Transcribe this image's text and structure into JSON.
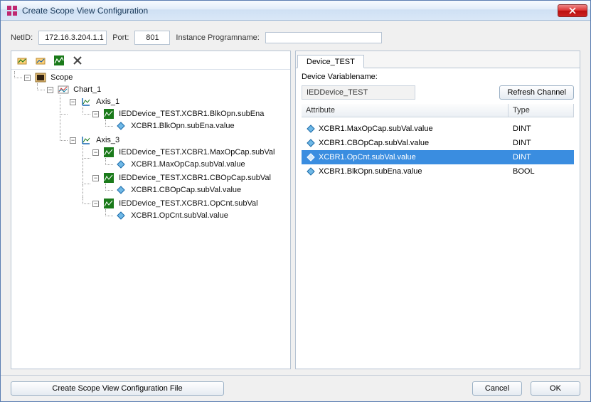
{
  "titlebar": {
    "title": "Create Scope View Configuration"
  },
  "form": {
    "netid_label": "NetID:",
    "netid_value": "172.16.3.204.1.1",
    "port_label": "Port:",
    "port_value": "801",
    "progname_label": "Instance Programname:",
    "progname_value": ""
  },
  "tree": {
    "root": {
      "label": "Scope",
      "chart": {
        "label": "Chart_1",
        "axis1": {
          "label": "Axis_1",
          "ch1": {
            "label": "IEDDevice_TEST.XCBR1.BlkOpn.subEna",
            "item": "XCBR1.BlkOpn.subEna.value"
          }
        },
        "axis3": {
          "label": "Axis_3",
          "ch1": {
            "label": "IEDDevice_TEST.XCBR1.MaxOpCap.subVal",
            "item": "XCBR1.MaxOpCap.subVal.value"
          },
          "ch2": {
            "label": "IEDDevice_TEST.XCBR1.CBOpCap.subVal",
            "item": "XCBR1.CBOpCap.subVal.value"
          },
          "ch3": {
            "label": "IEDDevice_TEST.XCBR1.OpCnt.subVal",
            "item": "XCBR1.OpCnt.subVal.value"
          }
        }
      }
    }
  },
  "right": {
    "tab": "Device_TEST",
    "varname_label": "Device Variablename:",
    "varname_value": "IEDDevice_TEST",
    "refresh_btn": "Refresh Channel",
    "col_attr": "Attribute",
    "col_type": "Type",
    "rows": [
      {
        "attr": "XCBR1.MaxOpCap.subVal.value",
        "type": "DINT",
        "selected": false
      },
      {
        "attr": "XCBR1.CBOpCap.subVal.value",
        "type": "DINT",
        "selected": false
      },
      {
        "attr": "XCBR1.OpCnt.subVal.value",
        "type": "DINT",
        "selected": true
      },
      {
        "attr": "XCBR1.BlkOpn.subEna.value",
        "type": "BOOL",
        "selected": false
      }
    ]
  },
  "footer": {
    "create_btn": "Create Scope View Configuration File",
    "cancel_btn": "Cancel",
    "ok_btn": "OK"
  }
}
